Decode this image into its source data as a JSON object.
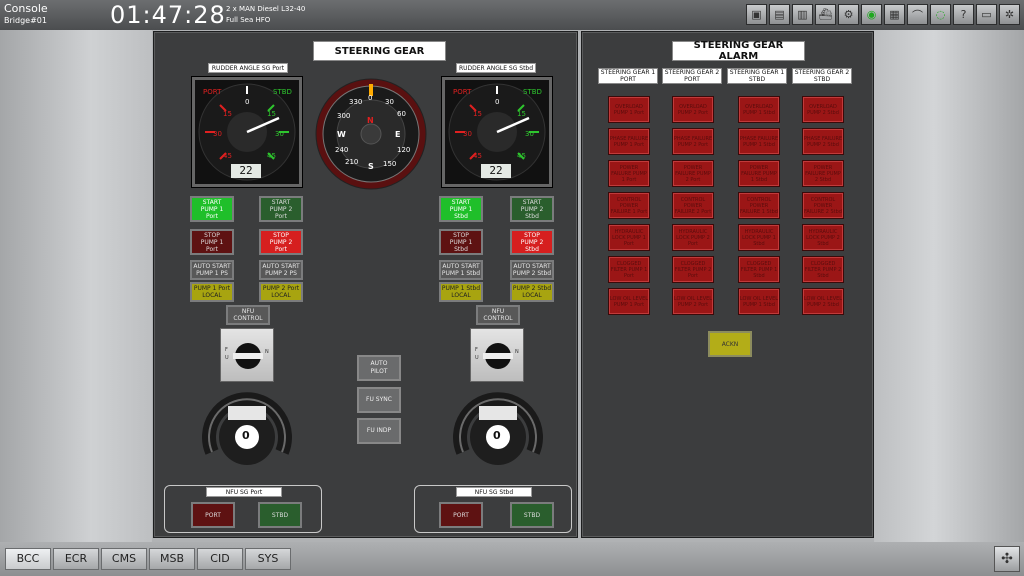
{
  "topbar": {
    "console": "Console",
    "bridge": "Bridge#01",
    "clock": "01:47:28",
    "engine": "2 x MAN Diesel L32-40",
    "mode": "Full Sea HFO",
    "icons": [
      "monitor-icon",
      "display-icon",
      "printer-icon",
      "ship-icon",
      "engine-icon",
      "eye-icon",
      "document-icon",
      "graph-icon",
      "chat-icon",
      "help-icon",
      "print-icon",
      "settings-icon"
    ]
  },
  "steering": {
    "title": "STEERING GEAR",
    "port_gauge_label": "RUDDER ANGLE SG Port",
    "stbd_gauge_label": "RUDDER ANGLE SG Stbd",
    "gauge_port_text": "PORT",
    "gauge_stbd_text": "STBD",
    "gauge_ticks": [
      "0",
      "15",
      "15",
      "30",
      "30",
      "45",
      "45"
    ],
    "port_rudder_angle": "22",
    "stbd_rudder_angle": "22",
    "compass_labels": [
      "0",
      "30",
      "60",
      "120",
      "150",
      "S",
      "210",
      "240",
      "W",
      "300",
      "330",
      "E",
      "N"
    ],
    "port": {
      "start1": [
        "START",
        "PUMP 1",
        "Port"
      ],
      "start2": [
        "START",
        "PUMP 2",
        "Port"
      ],
      "stop1": [
        "STOP",
        "PUMP 1",
        "Port"
      ],
      "stop2": [
        "STOP",
        "PUMP 2",
        "Port"
      ],
      "auto1": [
        "AUTO START",
        "PUMP 1 PS"
      ],
      "auto2": [
        "AUTO START",
        "PUMP 2 PS"
      ],
      "local1": [
        "PUMP 1 Port",
        "LOCAL"
      ],
      "local2": [
        "PUMP 2 Port",
        "LOCAL"
      ],
      "nfu_control": [
        "NFU",
        "CONTROL"
      ],
      "nfu_box_label": "NFU SG Port",
      "nfu_port": "PORT",
      "nfu_stbd": "STBD"
    },
    "stbd": {
      "start1": [
        "START",
        "PUMP 1",
        "Stbd"
      ],
      "start2": [
        "START",
        "PUMP 2",
        "Stbd"
      ],
      "stop1": [
        "STOP",
        "PUMP 1",
        "Stbd"
      ],
      "stop2": [
        "STOP",
        "PUMP 2",
        "Stbd"
      ],
      "auto1": [
        "AUTO START",
        "PUMP 1 Stbd"
      ],
      "auto2": [
        "AUTO START",
        "PUMP 2 Stbd"
      ],
      "local1": [
        "PUMP 1 Stbd",
        "LOCAL"
      ],
      "local2": [
        "PUMP 2 Stbd",
        "LOCAL"
      ],
      "nfu_control": [
        "NFU",
        "CONTROL"
      ],
      "nfu_box_label": "NFU SG Stbd",
      "nfu_port": "PORT",
      "nfu_stbd": "STBD"
    },
    "mid": {
      "autopilot": [
        "AUTO",
        "PILOT"
      ],
      "fu_sync": "FU SYNC",
      "fu_indp": "FU INDP"
    },
    "dial_value": "0",
    "selector_letters": [
      "F",
      "U",
      "N"
    ]
  },
  "alarm": {
    "title": "STEERING GEAR  ALARM",
    "headers": [
      [
        "STEERING GEAR 1",
        "PORT"
      ],
      [
        "STEERING GEAR 2",
        "PORT"
      ],
      [
        "STEERING GEAR 1",
        "STBD"
      ],
      [
        "STEERING GEAR 2",
        "STBD"
      ]
    ],
    "rows": [
      [
        "OVERLOAD PUMP 1 Port",
        "OVERLOAD PUMP 2 Port",
        "OVERLOAD PUMP 1 Stbd",
        "OVERLOAD PUMP 2 Stbd"
      ],
      [
        "PHASE FAILURE PUMP 1 Port",
        "PHASE FAILURE PUMP 2 Port",
        "PHASE FAILURE PUMP 1 Stbd",
        "PHASE FAILURE PUMP 2 Stbd"
      ],
      [
        "POWER FAILURE PUMP 1 Port",
        "POWER FAILURE PUMP 2 Port",
        "POWER FAILURE PUMP 1 Stbd",
        "POWER FAILURE PUMP 2 Stbd"
      ],
      [
        "CONTROL POWER FAILURE 1 Port",
        "CONTROL POWER FAILURE 2 Port",
        "CONTROL POWER FAILURE 1 Stbd",
        "CONTROL POWER FAILURE 2 Stbd"
      ],
      [
        "HYDRAULIC LOCK PUMP 1 Port",
        "HYDRAULIC LOCK PUMP 2 Port",
        "HYDRAULIC LOCK PUMP 1 Stbd",
        "HYDRAULIC LOCK PUMP 2 Stbd"
      ],
      [
        "CLOGGED FILTER PUMP 1 Port",
        "CLOGGED FILTER PUMP 2 Port",
        "CLOGGED FILTER PUMP 1 Stbd",
        "CLOGGED FILTER PUMP 2 Stbd"
      ],
      [
        "LOW OIL LEVEL PUMP 1 Port",
        "LOW OIL LEVEL PUMP 2 Port",
        "LOW OIL LEVEL PUMP 1 Stbd",
        "LOW OIL LEVEL PUMP 2 Stbd"
      ]
    ],
    "ackn": "ACKN"
  },
  "tabs": [
    "BCC",
    "ECR",
    "CMS",
    "MSB",
    "CID",
    "SYS"
  ],
  "colors": {
    "panel": "#3c3d3e",
    "green": "#1fbf2a",
    "red": "#d61f1f",
    "alarm": "#9b1616",
    "yellow": "#b3ad18"
  }
}
